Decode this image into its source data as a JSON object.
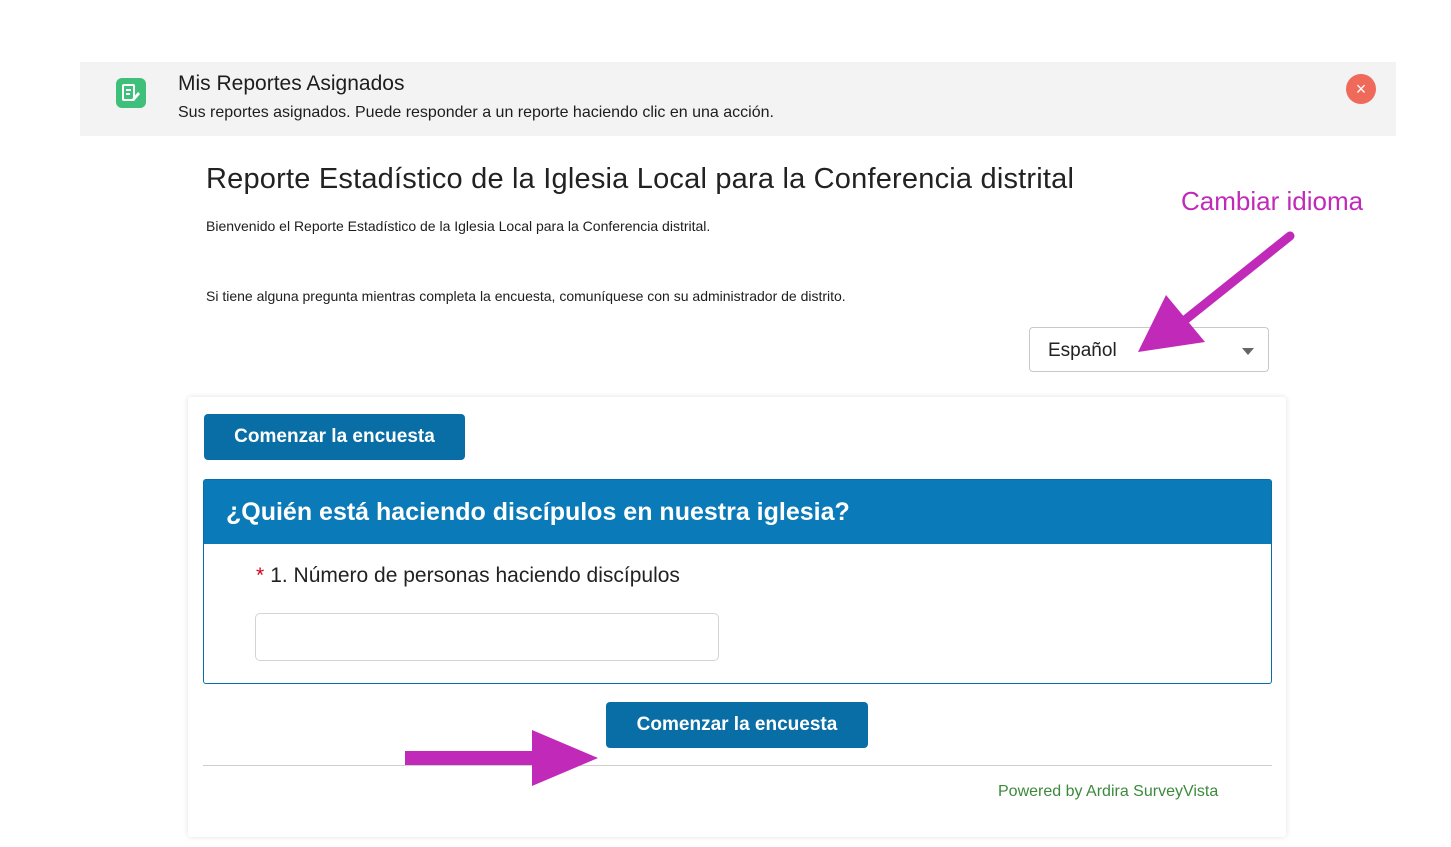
{
  "header": {
    "title": "Mis Reportes Asignados",
    "subtitle": "Sus reportes asignados. Puede responder a un reporte haciendo clic en una acción.",
    "close_label": "×"
  },
  "survey": {
    "title": "Reporte Estadístico de la Iglesia Local para la Conferencia distrital",
    "welcome": "Bienvenido el Reporte Estadístico de la Iglesia Local para la Conferencia distrital.",
    "help": "Si tiene alguna pregunta mientras completa la encuesta, comuníquese con su administrador de distrito."
  },
  "language_select": {
    "selected": "Español"
  },
  "annotations": {
    "language_label": "Cambiar idioma",
    "color": "#c12ab8"
  },
  "card": {
    "start_button_top": "Comenzar la encuesta",
    "section_title": "¿Quién está haciendo discípulos en nuestra iglesia?",
    "question": {
      "required_marker": "*",
      "label": "1. Número de personas haciendo discípulos",
      "value": ""
    },
    "start_button_bottom": "Comenzar la encuesta",
    "powered_by": "Powered by Ardira SurveyVista"
  },
  "colors": {
    "primary": "#0a6ea6",
    "section_header": "#0a7ab8",
    "app_icon": "#3fc07a",
    "close": "#ef6a5a",
    "powered_by": "#3b8a3b"
  },
  "icons": {
    "app": "survey-doc-icon",
    "close": "close-icon",
    "dropdown": "caret-down-icon"
  }
}
